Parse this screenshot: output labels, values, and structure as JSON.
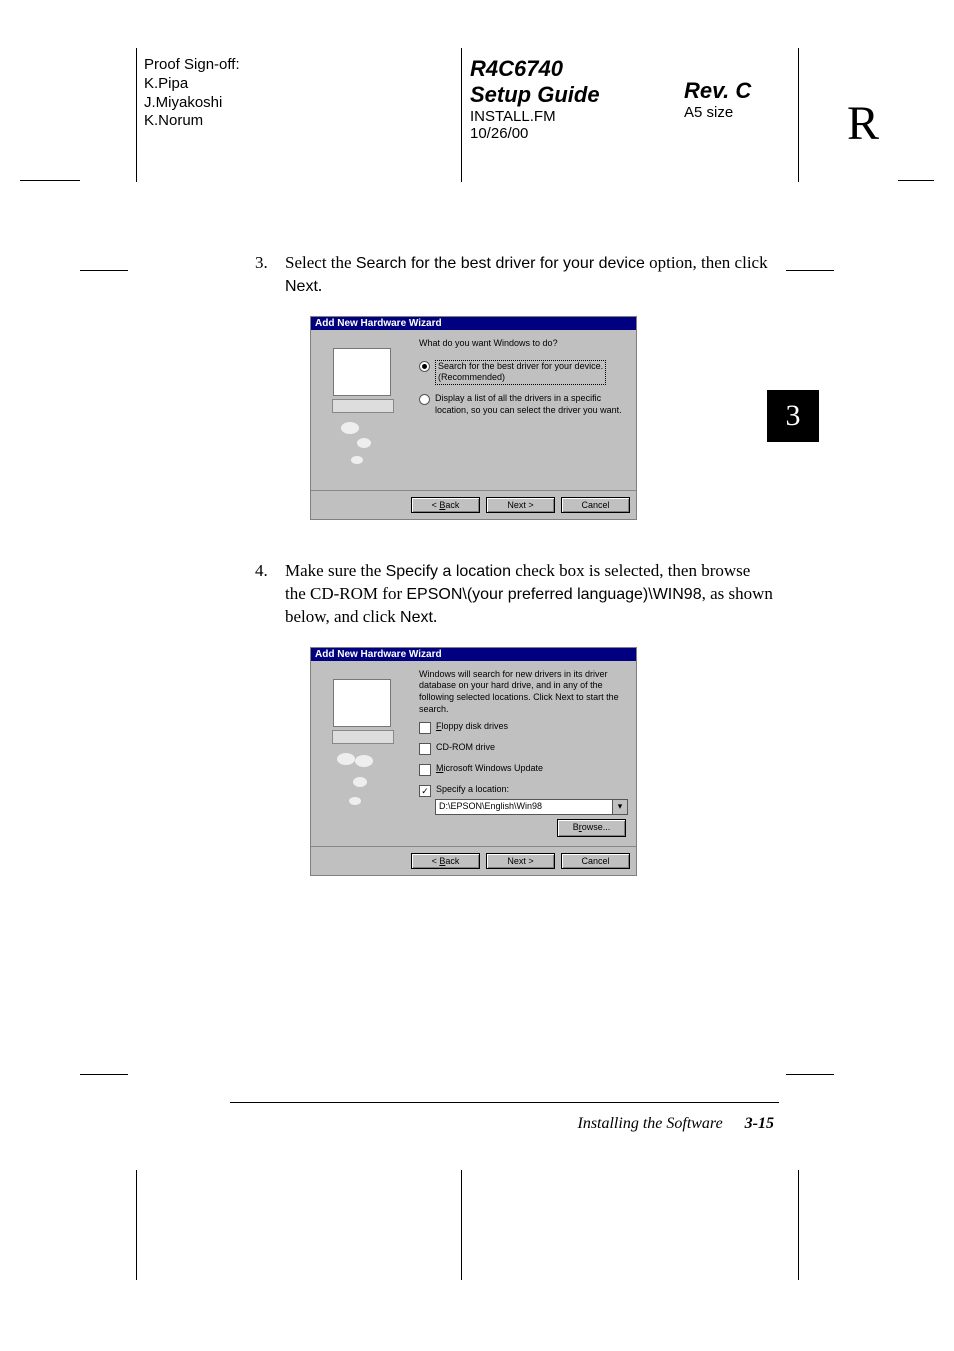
{
  "header": {
    "proof_label": "Proof Sign-off:",
    "proof1": "K.Pipa",
    "proof2": "J.Miyakoshi",
    "proof3": "K.Norum",
    "code": "R4C6740",
    "guide": "Setup Guide",
    "file": "INSTALL.FM",
    "date": "10/26/00",
    "rev": "Rev. C",
    "size": "A5 size",
    "big_r": "R"
  },
  "step3": {
    "num": "3.",
    "t1": "Select the ",
    "opt": "Search for the best driver for your device",
    "t2": " option, then click ",
    "next": "Next",
    "t3": "."
  },
  "shot3": {
    "title": "Add New Hardware Wizard",
    "prompt": "What do you want Windows to do?",
    "r1a": "Search for the best driver for your device.",
    "r1b": "(Recommended)",
    "r2": "Display a list of all the drivers in a specific location, so you can select the driver you want.",
    "back": "< Back",
    "next": "Next >",
    "cancel": "Cancel"
  },
  "step4": {
    "num": "4.",
    "t1": "Make sure the ",
    "opt": "Specify a location",
    "t2": " check box is selected, then browse the CD-ROM for ",
    "path": "EPSON\\(your preferred language)\\WIN98",
    "t3": ", as shown below, and click ",
    "next": "Next",
    "t4": "."
  },
  "shot4": {
    "title": "Add New Hardware Wizard",
    "prompt": "Windows will search for new drivers in its driver database on your hard drive, and in any of the following selected locations. Click Next to start the search.",
    "c1": "Floppy disk drives",
    "c2": "CD-ROM drive",
    "c3": "Microsoft Windows Update",
    "c4": "Specify a location:",
    "loc": "D:\\EPSON\\English\\Win98",
    "browse": "Browse...",
    "back": "< Back",
    "next": "Next >",
    "cancel": "Cancel"
  },
  "chapter": "3",
  "footer": {
    "section": "Installing the Software",
    "page": "3-15"
  }
}
